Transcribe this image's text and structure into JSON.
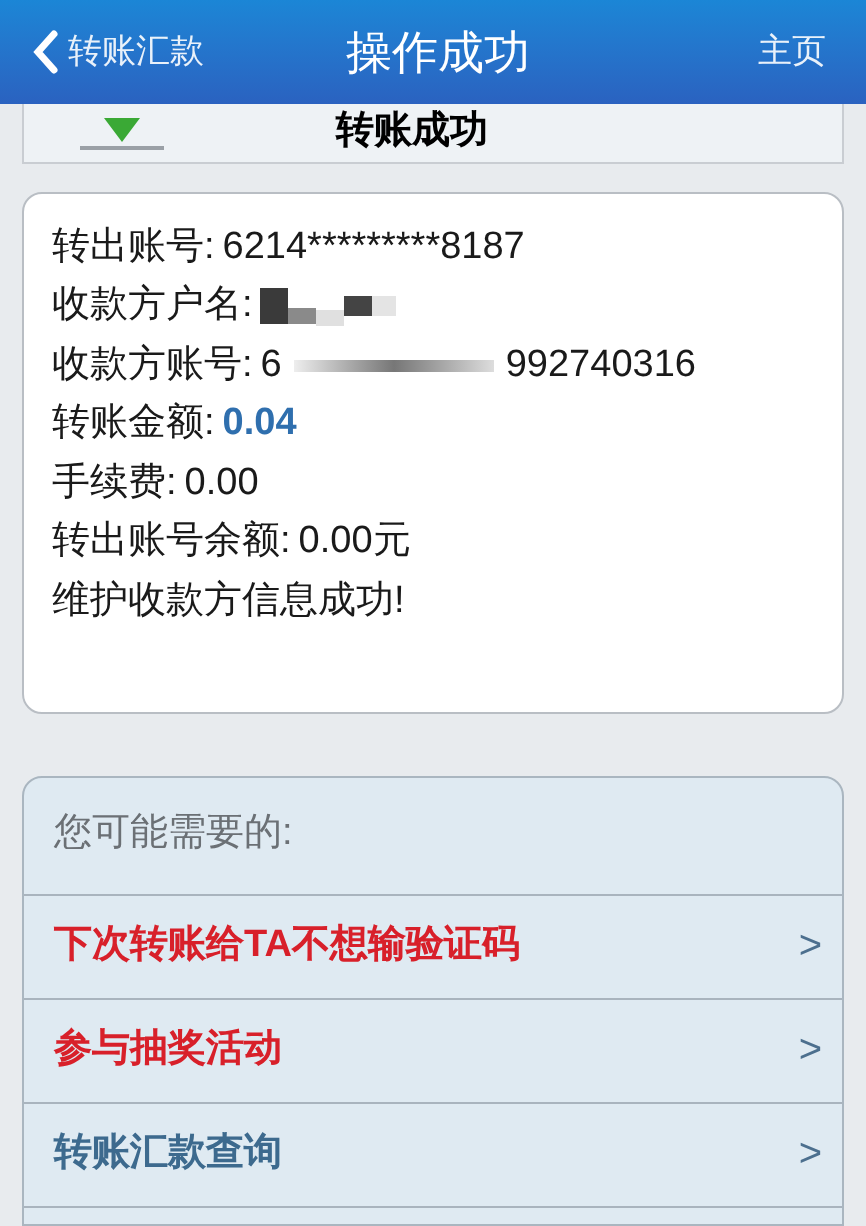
{
  "nav": {
    "back": "转账汇款",
    "title": "操作成功",
    "home": "主页"
  },
  "result": {
    "title": "转账成功"
  },
  "details": [
    {
      "kind": "text",
      "label": "转出账号:",
      "value": "6214*********8187"
    },
    {
      "kind": "masked",
      "label": "收款方户名:"
    },
    {
      "kind": "partial",
      "label": "收款方账号:",
      "prefix": "6",
      "suffix": "992740316"
    },
    {
      "kind": "amount",
      "label": "转账金额:",
      "value": "0.04"
    },
    {
      "kind": "text",
      "label": "手续费:",
      "value": "0.00"
    },
    {
      "kind": "text",
      "label": "转出账号余额:",
      "value": "0.00元"
    },
    {
      "kind": "message",
      "label": "维护收款方信息成功!"
    }
  ],
  "suggestions": {
    "heading": "您可能需要的:",
    "items": [
      {
        "label": "下次转账给TA不想输验证码",
        "color": "#d8202a",
        "arrow": ">"
      },
      {
        "label": "参与抽奖活动",
        "color": "#d8202a",
        "arrow": ">"
      },
      {
        "label": "转账汇款查询",
        "color": "#3d6a8e",
        "arrow": ">"
      }
    ]
  }
}
